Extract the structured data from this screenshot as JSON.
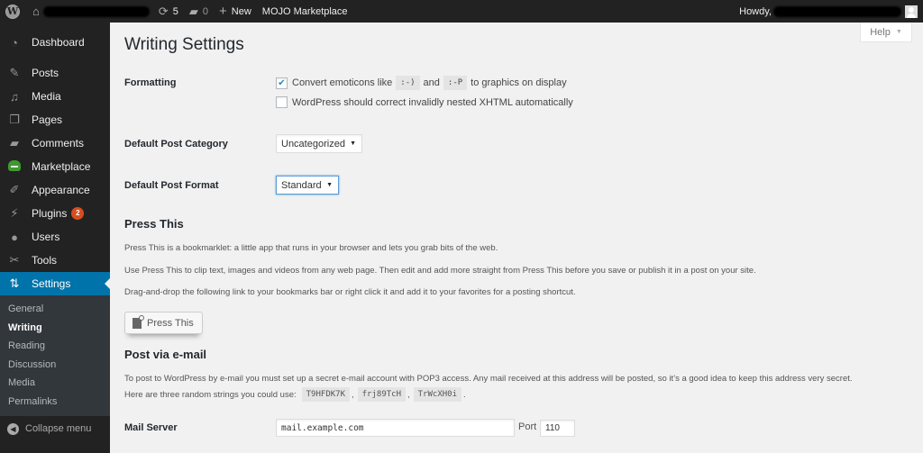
{
  "adminbar": {
    "updates_count": "5",
    "comments_count": "0",
    "new_label": "New",
    "marketplace_label": "MOJO Marketplace",
    "howdy_label": "Howdy,"
  },
  "sidebar": {
    "items": [
      {
        "label": "Dashboard",
        "icon": "dashboard-icon"
      },
      {
        "label": "Posts",
        "icon": "pushpin-icon"
      },
      {
        "label": "Media",
        "icon": "media-icon"
      },
      {
        "label": "Pages",
        "icon": "pages-icon"
      },
      {
        "label": "Comments",
        "icon": "comment-icon"
      },
      {
        "label": "Marketplace",
        "icon": "marketplace-icon"
      },
      {
        "label": "Appearance",
        "icon": "paintbrush-icon"
      },
      {
        "label": "Plugins",
        "icon": "plugin-icon",
        "badge": "2"
      },
      {
        "label": "Users",
        "icon": "users-icon"
      },
      {
        "label": "Tools",
        "icon": "wrench-icon"
      },
      {
        "label": "Settings",
        "icon": "settings-icon",
        "current": true
      }
    ],
    "submenu": [
      {
        "label": "General"
      },
      {
        "label": "Writing",
        "current": true
      },
      {
        "label": "Reading"
      },
      {
        "label": "Discussion"
      },
      {
        "label": "Media"
      },
      {
        "label": "Permalinks"
      }
    ],
    "collapse_label": "Collapse menu"
  },
  "main": {
    "help_label": "Help",
    "title": "Writing Settings",
    "formatting": {
      "label": "Formatting",
      "emoticons": {
        "checked": true,
        "text_before": "Convert emoticons like",
        "code1": ":-)",
        "text_and": "and",
        "code2": ":-P",
        "text_after": "to graphics on display"
      },
      "xhtml": {
        "checked": false,
        "text": "WordPress should correct invalidly nested XHTML automatically"
      }
    },
    "default_category": {
      "label": "Default Post Category",
      "value": "Uncategorized"
    },
    "default_format": {
      "label": "Default Post Format",
      "value": "Standard"
    },
    "press_this": {
      "heading": "Press This",
      "p1": "Press This is a bookmarklet: a little app that runs in your browser and lets you grab bits of the web.",
      "p2": "Use Press This to clip text, images and videos from any web page. Then edit and add more straight from Press This before you save or publish it in a post on your site.",
      "p3": "Drag-and-drop the following link to your bookmarks bar or right click it and add it to your favorites for a posting shortcut.",
      "button_label": "Press This"
    },
    "post_via_email": {
      "heading": "Post via e-mail",
      "p1": "To post to WordPress by e-mail you must set up a secret e-mail account with POP3 access. Any mail received at this address will be posted, so it’s a good idea to keep this address very secret.",
      "p2_prefix": "Here are three random strings you could use:",
      "strings": [
        "T9HFDK7K",
        "frj89TcH",
        "TrWcXH0i"
      ],
      "mail_server_label": "Mail Server",
      "mail_server_value": "mail.example.com",
      "port_label": "Port",
      "port_value": "110"
    }
  }
}
